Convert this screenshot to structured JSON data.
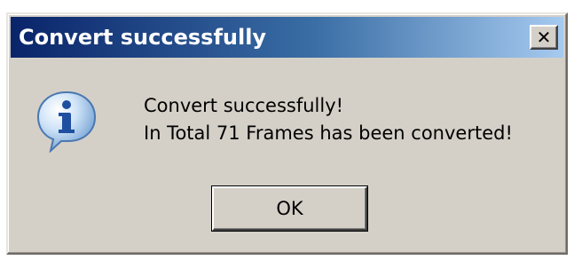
{
  "window": {
    "title": "Convert successfully",
    "close_label": "✕",
    "titlebar_color_start": "#0a246a",
    "titlebar_color_end": "#a6caf0"
  },
  "icon": {
    "name": "information-icon",
    "glyph": "i"
  },
  "message": {
    "line1": "Convert successfully!",
    "line2": "In Total 71 Frames has been converted!"
  },
  "buttons": {
    "ok_label": "OK"
  }
}
